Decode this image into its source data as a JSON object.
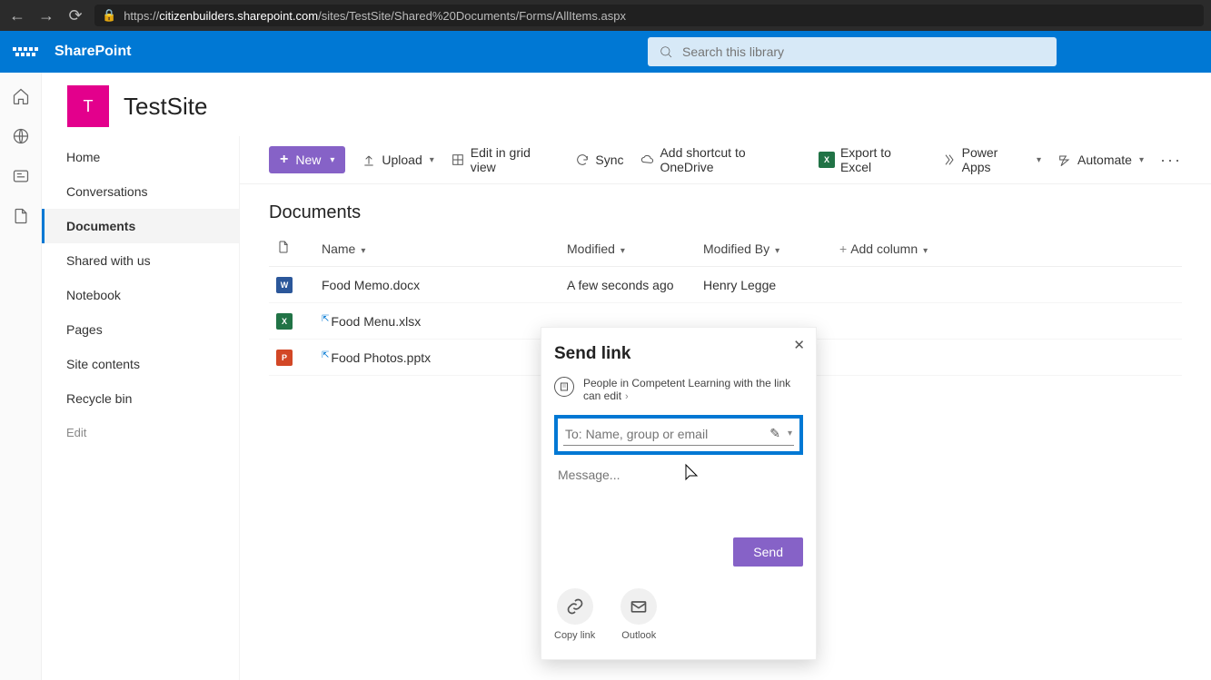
{
  "browser": {
    "url_prefix": "https://",
    "url_host": "citizenbuilders.sharepoint.com",
    "url_path": "/sites/TestSite/Shared%20Documents/Forms/AllItems.aspx"
  },
  "header": {
    "brand": "SharePoint",
    "search_placeholder": "Search this library"
  },
  "site": {
    "initial": "T",
    "title": "TestSite"
  },
  "leftnav": {
    "items": [
      {
        "label": "Home",
        "active": false
      },
      {
        "label": "Conversations",
        "active": false
      },
      {
        "label": "Documents",
        "active": true
      },
      {
        "label": "Shared with us",
        "active": false
      },
      {
        "label": "Notebook",
        "active": false
      },
      {
        "label": "Pages",
        "active": false
      },
      {
        "label": "Site contents",
        "active": false
      },
      {
        "label": "Recycle bin",
        "active": false
      }
    ],
    "edit": "Edit"
  },
  "cmdbar": {
    "new": "New",
    "upload": "Upload",
    "editgrid": "Edit in grid view",
    "sync": "Sync",
    "shortcut": "Add shortcut to OneDrive",
    "export": "Export to Excel",
    "powerapps": "Power Apps",
    "automate": "Automate"
  },
  "library": {
    "title": "Documents",
    "columns": {
      "name": "Name",
      "modified": "Modified",
      "modifiedby": "Modified By",
      "addcol": "Add column"
    },
    "rows": [
      {
        "icon": "docx",
        "name": "Food Memo.docx",
        "modified": "A few seconds ago",
        "modifiedby": "Henry Legge",
        "marker": false
      },
      {
        "icon": "xlsx",
        "name": "Food Menu.xlsx",
        "modified": "",
        "modifiedby": "",
        "marker": true
      },
      {
        "icon": "pptx",
        "name": "Food Photos.pptx",
        "modified": "",
        "modifiedby": "",
        "marker": true
      }
    ]
  },
  "dialog": {
    "title": "Send link",
    "perm": "People in Competent Learning with the link can edit",
    "to_placeholder": "To: Name, group or email",
    "msg_placeholder": "Message...",
    "send": "Send",
    "copy": "Copy link",
    "outlook": "Outlook"
  }
}
